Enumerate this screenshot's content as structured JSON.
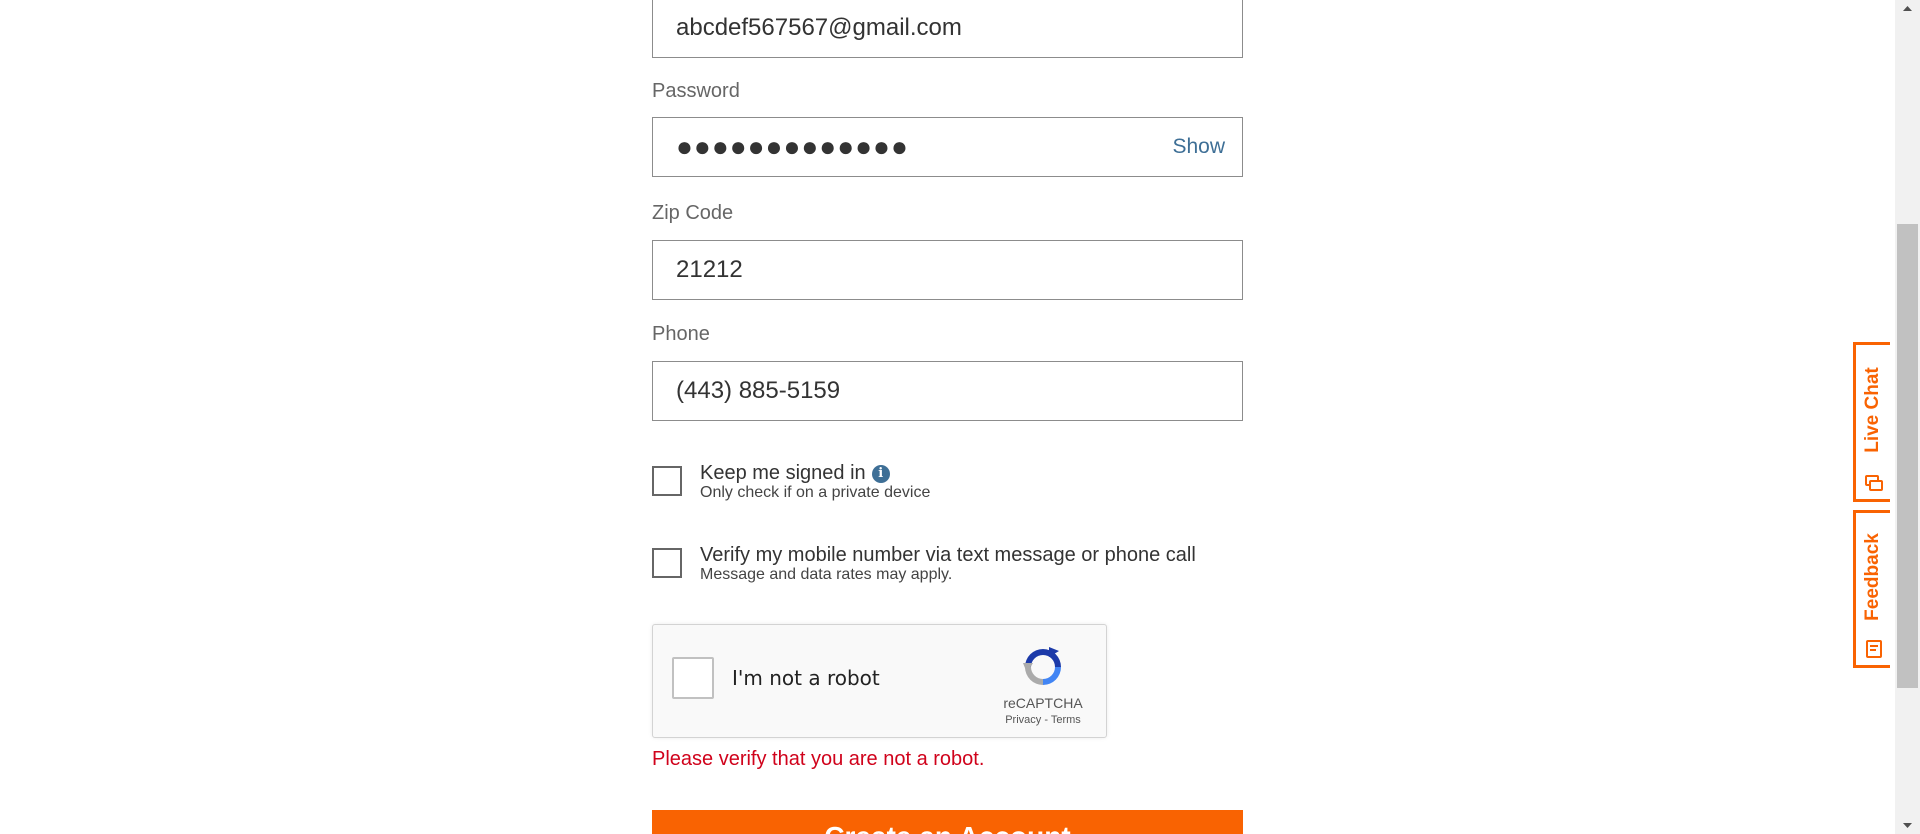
{
  "form": {
    "email": {
      "value": "abcdef567567@gmail.com"
    },
    "password": {
      "label": "Password",
      "value": "●●●●●●●●●●●●●",
      "toggle_label": "Show"
    },
    "zip": {
      "label": "Zip Code",
      "value": "21212"
    },
    "phone": {
      "label": "Phone",
      "value": "(443) 885-5159"
    },
    "keep_signed_in": {
      "label": "Keep me signed in",
      "info_icon": "i",
      "sub": "Only check if on a private device",
      "checked": false
    },
    "verify_mobile": {
      "label": "Verify my mobile number via text message or phone call",
      "sub": "Message and data rates may apply.",
      "checked": false
    },
    "recaptcha": {
      "label": "I'm not a robot",
      "brand": "reCAPTCHA",
      "privacy": "Privacy",
      "separator": " - ",
      "terms": "Terms"
    },
    "error": "Please verify that you are not a robot.",
    "submit_label": "Create an Account"
  },
  "side_tabs": {
    "live_chat": "Live Chat",
    "feedback": "Feedback"
  },
  "colors": {
    "accent": "#f96302",
    "link": "#3e6f96",
    "error": "#d0021b"
  },
  "icons": {
    "info": "info-icon",
    "chat": "chat-icon",
    "feedback": "feedback-icon",
    "recaptcha": "recaptcha-logo-icon"
  }
}
